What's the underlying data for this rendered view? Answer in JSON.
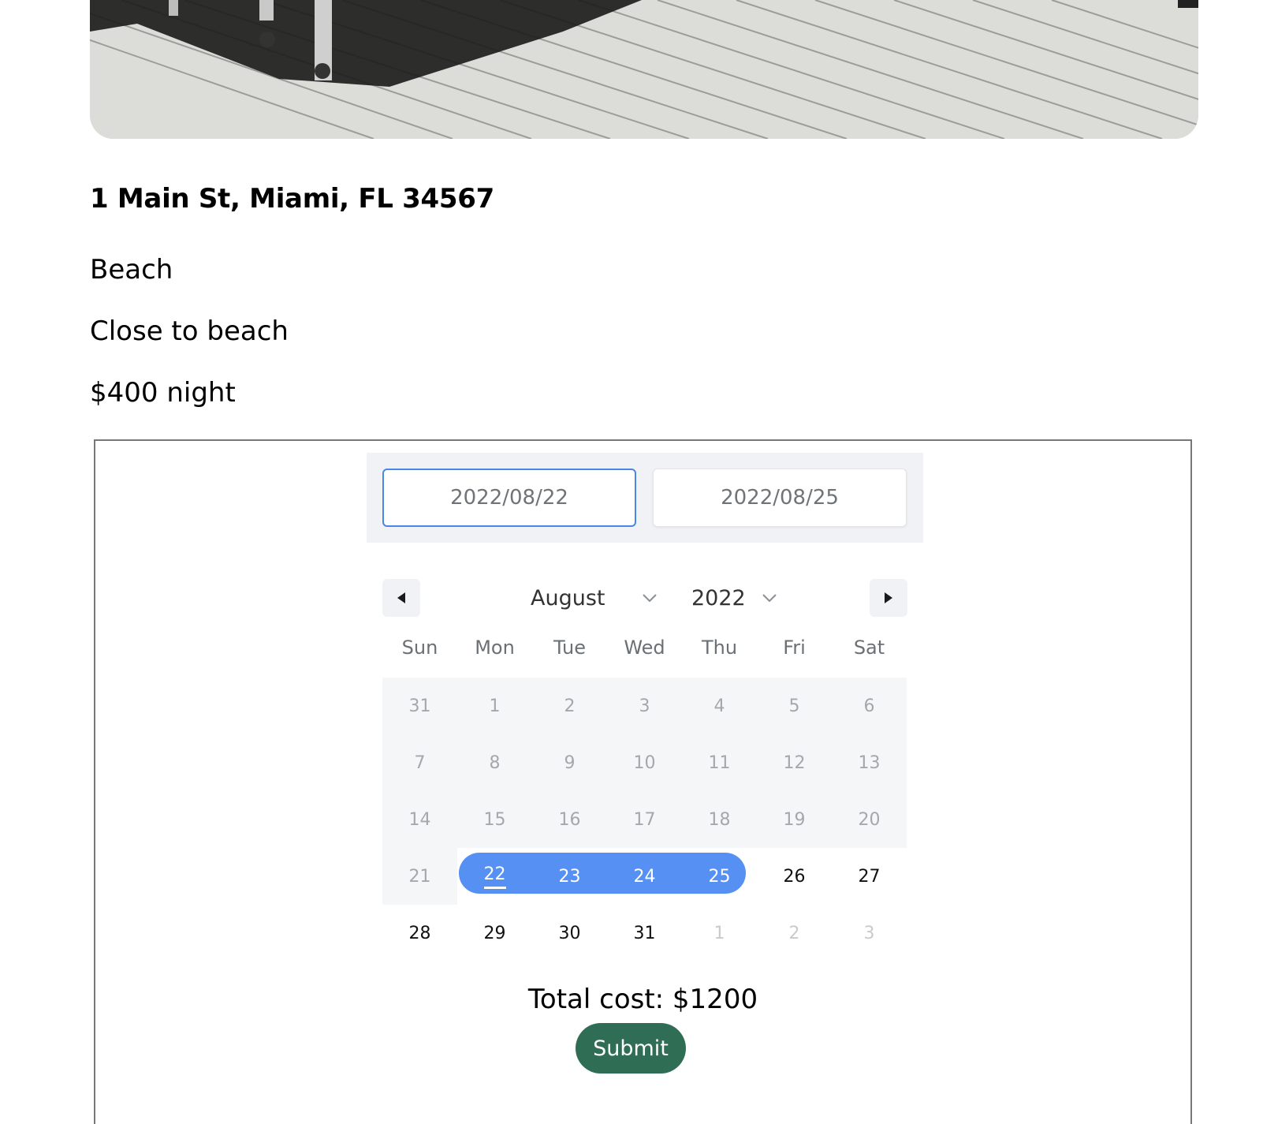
{
  "listing": {
    "address": "1 Main St, Miami, FL 34567",
    "type": "Beach",
    "description": "Close to beach",
    "price": "$400 night"
  },
  "booking": {
    "start_date": "2022/08/22",
    "end_date": "2022/08/25",
    "month": "August",
    "year": "2022",
    "prev_icon": "caret-left-icon",
    "next_icon": "caret-right-icon",
    "weekdays": [
      "Sun",
      "Mon",
      "Tue",
      "Wed",
      "Thu",
      "Fri",
      "Sat"
    ],
    "weeks": [
      [
        "31",
        "1",
        "2",
        "3",
        "4",
        "5",
        "6"
      ],
      [
        "7",
        "8",
        "9",
        "10",
        "11",
        "12",
        "13"
      ],
      [
        "14",
        "15",
        "16",
        "17",
        "18",
        "19",
        "20"
      ],
      [
        "21",
        "22",
        "23",
        "24",
        "25",
        "26",
        "27"
      ],
      [
        "28",
        "29",
        "30",
        "31",
        "1",
        "2",
        "3"
      ]
    ],
    "selected_range": [
      "22",
      "25"
    ],
    "total_cost": "Total cost: $1200",
    "submit_label": "Submit"
  },
  "colors": {
    "accent": "#5590f2",
    "focus_border": "#4a86e8",
    "submit": "#2f6e55",
    "disabled_bg": "#f5f6f7"
  }
}
